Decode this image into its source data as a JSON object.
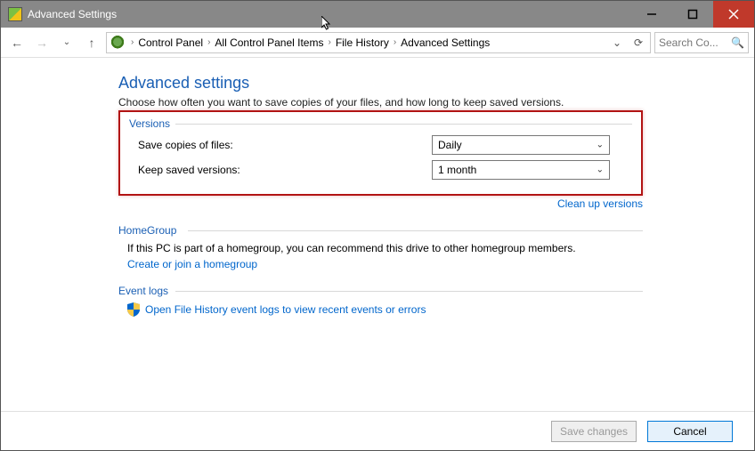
{
  "window": {
    "title": "Advanced Settings",
    "minimize_label": "Minimize",
    "maximize_label": "Maximize",
    "close_label": "Close"
  },
  "nav": {
    "back_label": "Back",
    "forward_label": "Forward",
    "up_label": "Up",
    "refresh_label": "Refresh",
    "breadcrumbs": [
      "Control Panel",
      "All Control Panel Items",
      "File History",
      "Advanced Settings"
    ],
    "search_placeholder": "Search Co..."
  },
  "page": {
    "title": "Advanced settings",
    "description": "Choose how often you want to save copies of your files, and how long to keep saved versions."
  },
  "versions": {
    "section_title": "Versions",
    "save_copies_label": "Save copies of files:",
    "save_copies_value": "Daily",
    "keep_versions_label": "Keep saved versions:",
    "keep_versions_value": "1 month",
    "cleanup_link": "Clean up versions"
  },
  "homegroup": {
    "section_title": "HomeGroup",
    "desc": "If this PC is part of a homegroup, you can recommend this drive to other homegroup members.",
    "link": "Create or join a homegroup"
  },
  "eventlogs": {
    "section_title": "Event logs",
    "link": "Open File History event logs to view recent events or errors"
  },
  "footer": {
    "save_label": "Save changes",
    "cancel_label": "Cancel"
  }
}
